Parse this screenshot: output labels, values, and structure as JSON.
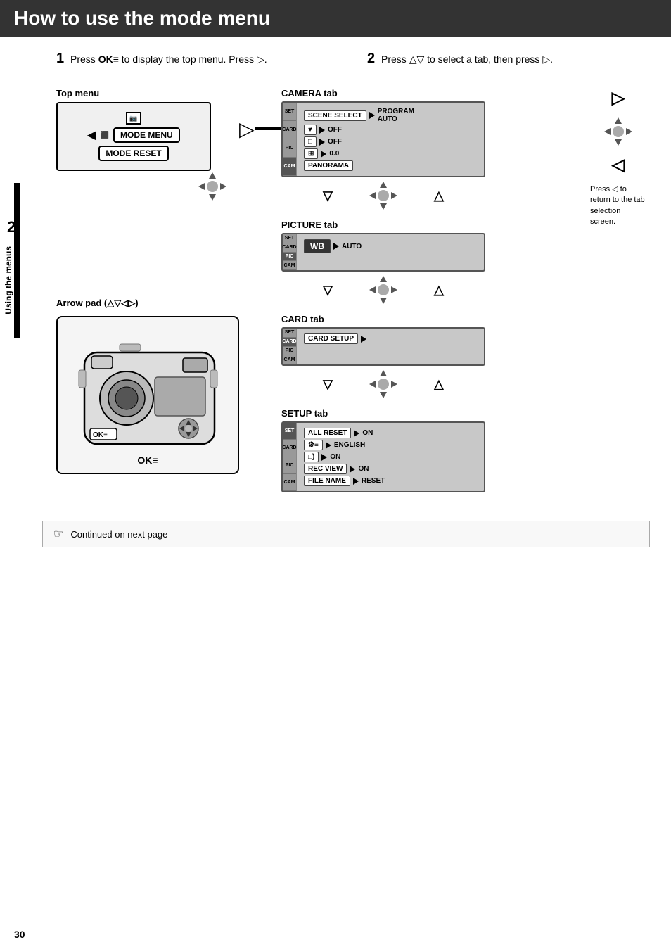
{
  "page": {
    "title": "How to use the mode menu",
    "page_number": "30",
    "chapter_number": "2",
    "chapter_label": "Using the menus"
  },
  "steps": [
    {
      "number": "1",
      "text": "Press ",
      "bold": "OK",
      "bold_icon": "≡",
      "rest": " to display the top menu. Press "
    },
    {
      "number": "2",
      "text": "Press △▽ to select a tab, then press ▷."
    }
  ],
  "top_menu_label": "Top menu",
  "camera_tab_label": "CAMERA tab",
  "picture_tab_label": "PICTURE tab",
  "card_tab_label": "CARD tab",
  "setup_tab_label": "SETUP tab",
  "press_left_note": "Press ◁ to return to the tab selection screen.",
  "arrow_pad_label": "Arrow pad (△▽◁▷)",
  "ok_label": "OK≡",
  "continued_text": "Continued on next page",
  "top_menu": {
    "row1": "MODE MENU",
    "row2": "MODE RESET"
  },
  "camera_tab": {
    "rows": [
      {
        "btn": "SCENE SELECT",
        "arrow": "▷",
        "value": "PROGRAM AUTO"
      },
      {
        "icon": "♥",
        "arrow": "▷",
        "value": "OFF"
      },
      {
        "icon": "□",
        "arrow": "▷",
        "value": "OFF"
      },
      {
        "icon": "⊞",
        "arrow": "▷",
        "value": "0.0"
      },
      {
        "btn": "PANORAMA",
        "arrow": "",
        "value": ""
      }
    ]
  },
  "picture_tab": {
    "rows": [
      {
        "btn": "WB",
        "arrow": "▷",
        "value": "AUTO"
      }
    ]
  },
  "card_tab": {
    "rows": [
      {
        "btn": "CARD SETUP",
        "arrow": "▷",
        "value": ""
      }
    ]
  },
  "setup_tab": {
    "rows": [
      {
        "btn": "ALL RESET",
        "arrow": "▷",
        "value": "ON"
      },
      {
        "icon": "⚙≡",
        "arrow": "▷",
        "value": "ENGLISH"
      },
      {
        "icon": "□)",
        "arrow": "▷",
        "value": "ON"
      },
      {
        "btn": "REC VIEW",
        "arrow": "▷",
        "value": "ON"
      },
      {
        "btn": "FILE NAME",
        "arrow": "▷",
        "value": "RESET"
      }
    ]
  },
  "icons": {
    "continued_icon": "☞",
    "ok_icon": "≡"
  }
}
